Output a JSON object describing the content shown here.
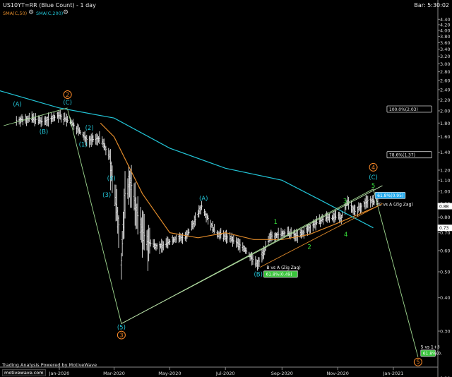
{
  "header": {
    "symbol_title": "US10YT=RR (Blue Count) - 1 day",
    "bar_timer": "Bar: 5:30:02",
    "indicators": [
      {
        "label": "SMA(C,50)",
        "color": "#e08a2a"
      },
      {
        "label": "SMA(C,200)",
        "color": "#22c4d6"
      }
    ]
  },
  "footer": {
    "credit": "Trading Analysis Powered by MotiveWave",
    "logo": "motivewave.com"
  },
  "chart_data": {
    "type": "line",
    "price_scale": "log",
    "ylim": [
      0.22,
      4.6
    ],
    "y_ticks": [
      "4.40",
      "4.20",
      "4.00",
      "3.80",
      "3.60",
      "3.40",
      "3.20",
      "3.00",
      "2.80",
      "2.60",
      "2.40",
      "2.20",
      "2.00",
      "1.80",
      "1.60",
      "1.40",
      "1.20",
      "1.10",
      "1.00",
      "0.90",
      "0.80",
      "0.70",
      "0.60",
      "0.50",
      "0.40",
      "0.30",
      "0.20"
    ],
    "x_ticks": [
      "Jan-2020",
      "Mar-2020",
      "May-2020",
      "Jul-2020",
      "Sep-2020",
      "Nov-2020",
      "Jan-2021"
    ],
    "price_tags": [
      {
        "label": "0.88",
        "value": 0.88
      },
      {
        "label": "0.73",
        "value": 0.73
      }
    ],
    "price_bars": [
      {
        "date": "2019-11-15",
        "close": 1.84
      },
      {
        "date": "2019-12-01",
        "close": 1.88
      },
      {
        "date": "2019-12-13",
        "close": 1.82
      },
      {
        "date": "2020-01-01",
        "close": 1.92
      },
      {
        "date": "2020-01-15",
        "close": 1.8
      },
      {
        "date": "2020-02-01",
        "close": 1.55
      },
      {
        "date": "2020-02-15",
        "close": 1.58
      },
      {
        "date": "2020-02-25",
        "close": 1.35
      },
      {
        "date": "2020-03-06",
        "close": 0.75
      },
      {
        "date": "2020-03-09",
        "close": 0.55
      },
      {
        "date": "2020-03-13",
        "close": 0.98
      },
      {
        "date": "2020-03-19",
        "close": 1.1
      },
      {
        "date": "2020-03-25",
        "close": 0.85
      },
      {
        "date": "2020-04-05",
        "close": 0.65
      },
      {
        "date": "2020-04-20",
        "close": 0.62
      },
      {
        "date": "2020-05-05",
        "close": 0.66
      },
      {
        "date": "2020-05-20",
        "close": 0.68
      },
      {
        "date": "2020-06-05",
        "close": 0.88
      },
      {
        "date": "2020-06-20",
        "close": 0.7
      },
      {
        "date": "2020-07-05",
        "close": 0.67
      },
      {
        "date": "2020-07-20",
        "close": 0.62
      },
      {
        "date": "2020-08-05",
        "close": 0.53
      },
      {
        "date": "2020-08-20",
        "close": 0.68
      },
      {
        "date": "2020-09-05",
        "close": 0.7
      },
      {
        "date": "2020-09-20",
        "close": 0.68
      },
      {
        "date": "2020-10-05",
        "close": 0.75
      },
      {
        "date": "2020-10-20",
        "close": 0.8
      },
      {
        "date": "2020-11-05",
        "close": 0.8
      },
      {
        "date": "2020-11-12",
        "close": 0.92
      },
      {
        "date": "2020-11-20",
        "close": 0.84
      },
      {
        "date": "2020-12-05",
        "close": 0.93
      },
      {
        "date": "2020-12-15",
        "close": 0.9
      }
    ],
    "series": [
      {
        "name": "SMA(C,50)",
        "color": "#e08a2a",
        "points": [
          {
            "date": "2020-02-15",
            "value": 1.8
          },
          {
            "date": "2020-03-01",
            "value": 1.6
          },
          {
            "date": "2020-04-01",
            "value": 0.98
          },
          {
            "date": "2020-05-01",
            "value": 0.7
          },
          {
            "date": "2020-06-01",
            "value": 0.67
          },
          {
            "date": "2020-07-01",
            "value": 0.7
          },
          {
            "date": "2020-08-01",
            "value": 0.66
          },
          {
            "date": "2020-09-01",
            "value": 0.66
          },
          {
            "date": "2020-10-01",
            "value": 0.69
          },
          {
            "date": "2020-11-01",
            "value": 0.76
          },
          {
            "date": "2020-12-15",
            "value": 0.88
          }
        ]
      },
      {
        "name": "SMA(C,200)",
        "color": "#22c4d6",
        "points": [
          {
            "date": "2019-10-20",
            "value": 2.42
          },
          {
            "date": "2020-01-01",
            "value": 2.05
          },
          {
            "date": "2020-03-01",
            "value": 1.88
          },
          {
            "date": "2020-05-01",
            "value": 1.45
          },
          {
            "date": "2020-07-01",
            "value": 1.22
          },
          {
            "date": "2020-09-01",
            "value": 1.1
          },
          {
            "date": "2020-10-15",
            "value": 0.92
          },
          {
            "date": "2020-12-10",
            "value": 0.73
          }
        ]
      }
    ],
    "wave_path": [
      {
        "date": "2020-01-10",
        "value": 2.03
      },
      {
        "date": "2020-03-09",
        "value": 0.32
      },
      {
        "date": "2020-12-10",
        "value": 1.02
      },
      {
        "date": "2021-01-28",
        "value": 0.24
      }
    ],
    "channel_line": [
      {
        "date": "2019-11-01",
        "value": 1.76
      },
      {
        "date": "2020-01-10",
        "value": 2.05
      }
    ],
    "trendlines": [
      {
        "from": {
          "date": "2020-03-09",
          "value": 0.32
        },
        "to": {
          "date": "2020-12-20",
          "value": 1.05
        },
        "color": "#b8dca8"
      },
      {
        "from": {
          "date": "2020-08-08",
          "value": 0.52
        },
        "to": {
          "date": "2020-12-20",
          "value": 0.9
        },
        "color": "#e08a2a"
      }
    ],
    "wave_labels": [
      {
        "text": "2",
        "date": "2020-01-10",
        "value": 2.3,
        "style": "circle",
        "color": "#ff8c2a"
      },
      {
        "text": "(C)",
        "date": "2020-01-10",
        "value": 2.15,
        "style": "plain",
        "color": "#22c4d6"
      },
      {
        "text": "(A)",
        "date": "2019-11-16",
        "value": 2.12,
        "style": "plain",
        "color": "#22c4d6"
      },
      {
        "text": "(B)",
        "date": "2019-12-15",
        "value": 1.67,
        "style": "plain",
        "color": "#22c4d6"
      },
      {
        "text": "(2)",
        "date": "2020-02-03",
        "value": 1.73,
        "style": "plain",
        "color": "#22c4d6"
      },
      {
        "text": "(1)",
        "date": "2020-01-27",
        "value": 1.5,
        "style": "plain",
        "color": "#22c4d6"
      },
      {
        "text": "(4)",
        "date": "2020-02-27",
        "value": 1.12,
        "style": "plain",
        "color": "#22c4d6"
      },
      {
        "text": "(3)",
        "date": "2020-02-22",
        "value": 0.97,
        "style": "plain",
        "color": "#22c4d6"
      },
      {
        "text": "(A)",
        "date": "2020-06-07",
        "value": 0.94,
        "style": "plain",
        "color": "#22c4d6"
      },
      {
        "text": "(5)",
        "date": "2020-03-09",
        "value": 0.31,
        "style": "plain",
        "color": "#22c4d6"
      },
      {
        "text": "3",
        "date": "2020-03-09",
        "value": 0.29,
        "style": "circle",
        "color": "#ff8c2a"
      },
      {
        "text": "(B)",
        "date": "2020-08-06",
        "value": 0.49,
        "style": "plain",
        "color": "#22c4d6"
      },
      {
        "text": "1",
        "date": "2020-08-25",
        "value": 0.77,
        "style": "plain",
        "color": "#36e03a"
      },
      {
        "text": "2",
        "date": "2020-10-01",
        "value": 0.62,
        "style": "plain",
        "color": "#36e03a"
      },
      {
        "text": "3",
        "date": "2020-11-09",
        "value": 0.92,
        "style": "plain",
        "color": "#36e03a"
      },
      {
        "text": "4",
        "date": "2020-11-10",
        "value": 0.69,
        "style": "plain",
        "color": "#36e03a"
      },
      {
        "text": "5",
        "date": "2020-12-10",
        "value": 1.05,
        "style": "plain",
        "color": "#36e03a"
      },
      {
        "text": "(C)",
        "date": "2020-12-10",
        "value": 1.13,
        "style": "plain",
        "color": "#22c4d6"
      },
      {
        "text": "4",
        "date": "2020-12-10",
        "value": 1.23,
        "style": "circle",
        "color": "#ff8c2a"
      },
      {
        "text": "5",
        "date": "2021-01-28",
        "value": 0.23,
        "style": "circle",
        "color": "#ff8c2a"
      }
    ],
    "annotations": [
      {
        "kind": "box",
        "text": "100.0%(2.03)",
        "value": 2.03,
        "x_from": "2020-12-25",
        "x_to": "2021-02-12",
        "border": "#cfcfcf",
        "fill": "#000000",
        "text_color": "#e8e8e8"
      },
      {
        "kind": "box",
        "text": "78.6%(1.37)",
        "value": 1.37,
        "x_from": "2020-12-25",
        "x_to": "2021-02-12",
        "border": "#cfcfcf",
        "fill": "#000000",
        "text_color": "#e8e8e8"
      },
      {
        "kind": "box",
        "text": "61.8%(0.95)",
        "value": 0.965,
        "x_from": "2020-12-12",
        "x_to": "2021-01-14",
        "border": "#cfcfcf",
        "fill": "#22aaee",
        "text_color": "#ffffff"
      },
      {
        "kind": "text",
        "text": "C vs A (Zig Zag)",
        "value": 0.895,
        "date": "2020-12-16",
        "text_color": "#ffffff"
      },
      {
        "kind": "text",
        "text": "B vs A (Zig Zag)",
        "value": 0.52,
        "date": "2020-08-15",
        "text_color": "#ffffff"
      },
      {
        "kind": "box",
        "text": "61.8%(0.49)",
        "value": 0.49,
        "x_from": "2020-08-12",
        "x_to": "2020-09-18",
        "border": "#cfcfcf",
        "fill": "#39c43b",
        "text_color": "#ffffff"
      },
      {
        "kind": "text",
        "text": "5 vs 1+3",
        "value": 0.262,
        "date": "2021-01-31",
        "text_color": "#ffffff"
      },
      {
        "kind": "box",
        "text": "61.8%(0.",
        "value": 0.248,
        "x_from": "2021-01-31",
        "x_to": "2021-02-16",
        "border": "#cfcfcf",
        "fill": "#39c43b",
        "text_color": "#ffffff"
      }
    ]
  }
}
